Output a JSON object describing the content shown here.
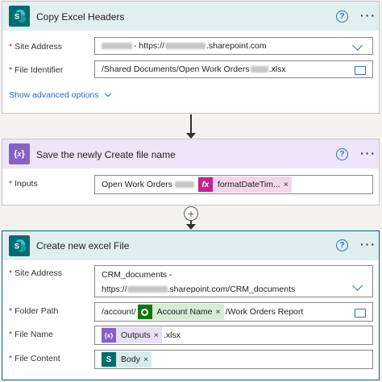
{
  "colors": {
    "sharepoint": "#036c70",
    "variables": "#8661c5",
    "dataverse": "#0e7a0d",
    "accent": "#2b6cc4",
    "header1": "#e0f0ef",
    "header2": "#ede5f8",
    "header3": "#dfefee",
    "expression": "#bd2590"
  },
  "card1": {
    "title": "Copy Excel Headers",
    "site_address_label": "Site Address",
    "site_address_value": "- https://",
    "site_address_suffix": ".sharepoint.com",
    "file_identifier_label": "File Identifier",
    "file_identifier_value": "/Shared Documents/Open Work Orders",
    "file_identifier_suffix": ".xlsx",
    "advanced_link": "Show advanced options"
  },
  "card2": {
    "title": "Save the newly Create file name",
    "inputs_label": "Inputs",
    "inputs_text": "Open Work Orders",
    "token_label": "formatDateTim...",
    "token_icon": "fx"
  },
  "card3": {
    "title": "Create new excel File",
    "site_address_label": "Site Address",
    "site_address_line1": "CRM_documents -",
    "site_address_line2_prefix": "https://",
    "site_address_line2_suffix": ".sharepoint.com/CRM_documents",
    "folder_path_label": "Folder Path",
    "folder_path_prefix": "/account/",
    "folder_token": "Account Name",
    "folder_path_suffix": "/Work Orders Report",
    "file_name_label": "File Name",
    "file_name_token": "Outputs",
    "file_name_suffix": ".xlsx",
    "file_content_label": "File Content",
    "file_content_token": "Body"
  },
  "required_mark": "*",
  "help_glyph": "?",
  "more_glyph": "···",
  "remove_glyph": "×",
  "plus_glyph": "+"
}
